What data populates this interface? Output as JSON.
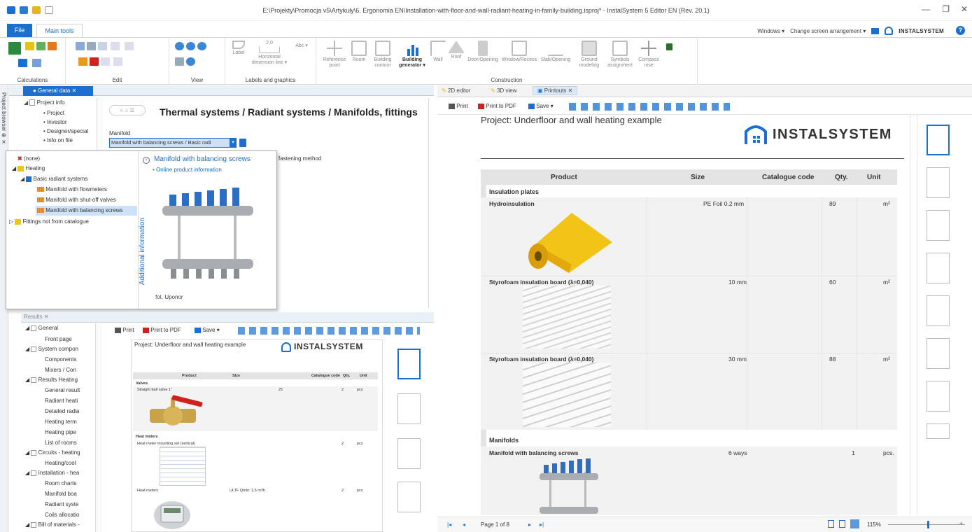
{
  "window": {
    "title": "E:\\Projekty\\Promocja v5\\Artykuły\\6. Ergonomia EN\\Installation-with-floor-and-wall-radiant-heating-in-family-building.isproj* - InstalSystem 5 Editor EN (Rev. 20.1)",
    "minimize": "—",
    "restore": "❐",
    "close": "✕"
  },
  "ribbon_tabs": {
    "file": "File",
    "main": "Main tools",
    "windows": "Windows ▾",
    "change_arrangement": "Change screen arrangement ▾",
    "brand": "INSTALSYSTEM",
    "help": "?"
  },
  "ribbon": {
    "groups": {
      "calculations": "Calculations",
      "edit": "Edit",
      "view": "View",
      "labels": "Labels and graphics",
      "construction": "Construction"
    },
    "buttons": {
      "label": "Label",
      "horizontal_dim": "Horizontal dimension line ▾",
      "reference_point": "Reference point",
      "room": "Room",
      "building_contour": "Building contour",
      "building_generator": "Building generator ▾",
      "wall": "Wall",
      "roof": "Roof",
      "door": "Door/Opening",
      "window": "Window/Recess",
      "slab": "Slab/Opening",
      "ground": "Ground modeling",
      "symbols": "Symbols assignment",
      "compass": "Compass rose",
      "abc": "Abc ▾",
      "dim_value": "2,0"
    }
  },
  "left_strip": "Project browser ⊕ ✕",
  "general_data": {
    "tab": "● General data  ✕",
    "tree": [
      "Project info",
      "• Project",
      "• Investor",
      "• Designer/special",
      "• Info on file"
    ],
    "back": "« ⌂ ☰",
    "page_title": "Thermal systems / Radiant systems / Manifolds, fittings",
    "manifold_label": "Manifold",
    "manifold_value": "Manifold with balancing screws / Basic radi",
    "fastening": "fastening method"
  },
  "popup": {
    "none": "(none)",
    "heating": "Heating",
    "basic": "Basic radiant systems",
    "flowmeters": "Manifold with flowmeters",
    "shutoff": "Manifold with shut-off valves",
    "balancing": "Manifold with balancing screws",
    "fittings": "Fittings not from catalogue",
    "info_title": "Manifold with balancing screws",
    "info_link": "• Online product information",
    "additional": "Additional information",
    "photo_credit": "fot. Uponor"
  },
  "results": {
    "tab": "Results  ✕",
    "tree": [
      "General",
      "Front page",
      "System compon",
      "Components",
      "Mixers / Con",
      "Results Heating",
      "General result",
      "Radiant heati",
      "Detailed radia",
      "Heating term",
      "Heating pipe",
      "List of rooms",
      "Circuits - heating",
      "Heating/cool",
      "Installation - hea",
      "Room charts",
      "Manifold boa",
      "Radiant syste",
      "Coils allocatio",
      "Bill of materials -"
    ],
    "toolbar": {
      "print": "Print",
      "print_pdf": "Print to PDF",
      "save": "Save ▾"
    },
    "doc": {
      "project": "Project: Underfloor and wall heating example",
      "head": [
        "Product",
        "Size",
        "Catalogue code",
        "Qty.",
        "Unit"
      ],
      "sec_valves": "Valves",
      "row1": "Straight ball valve 1\"",
      "row1_size": "25",
      "row1_qty": "2",
      "row1_unit": "pcs",
      "sec_heat": "Heat meters",
      "row2": "Heat meter mounting set (vertical)",
      "row2_qty": "2",
      "row2_unit": "pcs",
      "row3": "Heat meters",
      "row3_size": "ULTF Qmin: 1,5 m³/h",
      "row3_qty": "2",
      "row3_unit": "pcs"
    }
  },
  "right": {
    "tabs": {
      "editor2d": "2D editor",
      "view3d": "3D view",
      "printouts": "Printouts  ✕"
    },
    "toolbar": {
      "print": "Print",
      "print_pdf": "Print to PDF",
      "save": "Save ▾"
    },
    "doc": {
      "project": "Project: Underfloor and wall heating example",
      "brand": "INSTALSYSTEM",
      "head": [
        "Product",
        "Size",
        "Catalogue code",
        "Qty.",
        "Unit"
      ],
      "sec_insulation": "Insulation plates",
      "r1_name": "Hydroinsulation",
      "r1_size": "PE Foil 0.2 mm",
      "r1_qty": "89",
      "r1_unit": "m²",
      "r2_name": "Styrofoam insulation board (λ=0,040)",
      "r2_size": "10 mm",
      "r2_qty": "60",
      "r2_unit": "m²",
      "r3_name": "Styrofoam insulation board (λ=0,040)",
      "r3_size": "30 mm",
      "r3_qty": "88",
      "r3_unit": "m²",
      "sec_manifolds": "Manifolds",
      "r4_name": "Manifold with balancing screws",
      "r4_size": "6 ways",
      "r4_qty": "1",
      "r4_unit": "pcs."
    },
    "status": {
      "page": "Page 1 of 8",
      "zoom": "115%"
    }
  },
  "colors": {
    "accent": "#1a6fd0",
    "yellow": "#f3c418",
    "red": "#d0221c"
  }
}
